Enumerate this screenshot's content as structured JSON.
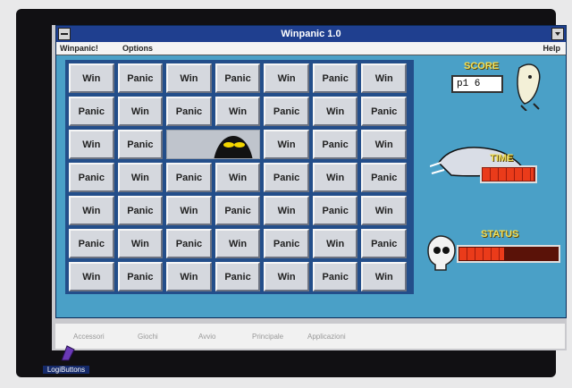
{
  "window": {
    "title": "Winpanic 1.0"
  },
  "menu": {
    "winpanic": "Winpanic!",
    "options": "Options",
    "help": "Help"
  },
  "grid": {
    "rows": [
      [
        "Win",
        "Panic",
        "Win",
        "Panic",
        "Win",
        "Panic",
        "Win"
      ],
      [
        "Panic",
        "Win",
        "Panic",
        "Win",
        "Panic",
        "Win",
        "Panic"
      ],
      [
        "Win",
        "Panic",
        "",
        "",
        "Win",
        "Panic",
        "Win"
      ],
      [
        "Panic",
        "Win",
        "Panic",
        "Win",
        "Panic",
        "Win",
        "Panic"
      ],
      [
        "Win",
        "Panic",
        "Win",
        "Panic",
        "Win",
        "Panic",
        "Win"
      ],
      [
        "Panic",
        "Win",
        "Panic",
        "Win",
        "Panic",
        "Win",
        "Panic"
      ],
      [
        "Win",
        "Panic",
        "Win",
        "Panic",
        "Win",
        "Panic",
        "Win"
      ]
    ]
  },
  "score": {
    "label": "SCORE",
    "value": "p1 6"
  },
  "time": {
    "label": "TIME",
    "level": 0.95
  },
  "status": {
    "label": "STATUS",
    "level": 0.45
  },
  "taskbar": [
    "Accessori",
    "Giochi",
    "Avvio",
    "Principale",
    "Applicazioni"
  ],
  "desktop": {
    "icon_label": "LogiButtons"
  }
}
